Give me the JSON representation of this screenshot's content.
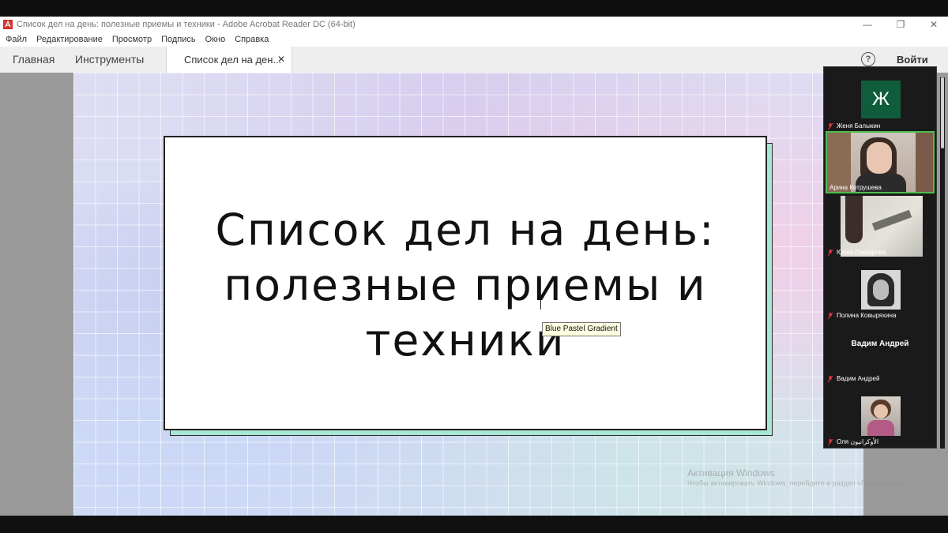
{
  "window": {
    "title": "Список дел на день: полезные приемы и техники - Adobe Acrobat Reader DC (64-bit)",
    "controls": {
      "minimize": "—",
      "restore": "❐",
      "close": "✕"
    }
  },
  "menu": [
    "Файл",
    "Редактирование",
    "Просмотр",
    "Подпись",
    "Окно",
    "Справка"
  ],
  "tabs": {
    "home": "Главная",
    "tools": "Инструменты",
    "document": "Список дел на ден...",
    "close": "✕",
    "help": "?",
    "signin": "Войти"
  },
  "slide": {
    "title_line1": "Список дел на день:",
    "title_line2": "полезные приемы и",
    "title_line3": "техники",
    "tooltip": "Blue Pastel Gradient",
    "colors": {
      "card_shadow": "#a8e7d6",
      "card": "#ffffff"
    }
  },
  "watermark": {
    "line1": "Активация Windows",
    "line2": "Чтобы активировать Windows, перейдите в раздел «Параметры»."
  },
  "participants": [
    {
      "name": "Женя Балыкин",
      "initial": "Ж",
      "type": "initial"
    },
    {
      "name": "Арина Котрушева",
      "type": "video",
      "active": true
    },
    {
      "name": "Юлия Гончарова",
      "type": "video"
    },
    {
      "name": "Полина Ковыряхина",
      "type": "video"
    },
    {
      "name": "Вадим Андрей",
      "display": "Вадим Андрей",
      "type": "name"
    },
    {
      "name": "Оля الأوكرانيون",
      "type": "video"
    }
  ]
}
